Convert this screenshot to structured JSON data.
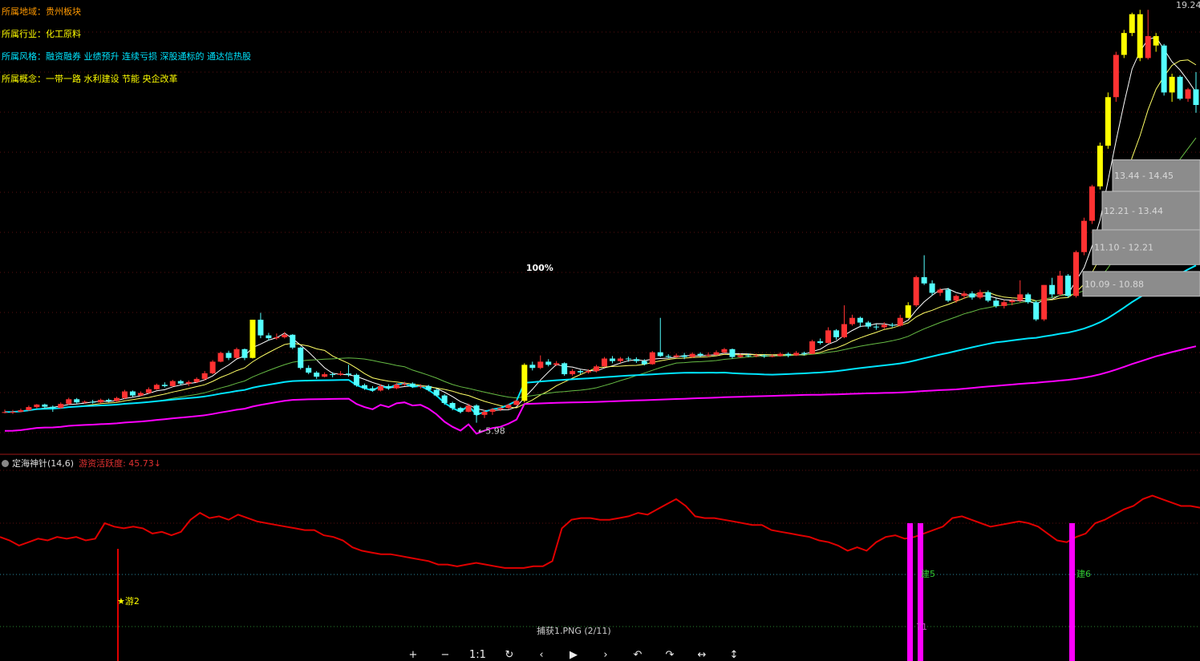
{
  "info": {
    "region_label": "所属地域：",
    "region_value": "贵州板块",
    "industry_label": "所属行业：",
    "industry_value": "化工原料",
    "style_label": "所属风格：",
    "style_value": "融资融券 业绩预升 连续亏损 深股通标的 通达信热股",
    "concept_label": "所属概念：",
    "concept_value": "一带一路 水利建设 节能 央企改革"
  },
  "colors": {
    "up": "#ff3232",
    "down": "#54ffff",
    "limit_up": "#ffff00",
    "ma60": "#00e5ff",
    "ma120": "#ff00ff",
    "indicator": "#e00000",
    "signal": "#ff00ff",
    "region": "#ff9900",
    "industry": "#ffff00",
    "style": "#00e5ff",
    "concept": "#ffff00"
  },
  "indicator": {
    "name": "定海神针(14,6)",
    "value_label": "游资活跃度:",
    "value": "45.73",
    "arrow": "↓"
  },
  "viewer": {
    "title": "捕获1.PNG (2/11)",
    "buttons": [
      "+",
      "−",
      "1:1",
      "↻",
      "‹",
      "▶",
      "›",
      "↶",
      "↷",
      "↔",
      "↕"
    ]
  },
  "chart_data": [
    {
      "type": "candlestick",
      "annotations": {
        "low_label": "←5.98",
        "pct_label": "100%",
        "high_label": "19.24",
        "chip_ranges": [
          "13.44 - 14.45",
          "12.21 - 13.44",
          "11.10 - 12.21",
          "10.09 - 10.88"
        ]
      },
      "ylim": [
        5.4,
        19.4
      ],
      "candles": [
        [
          6.37,
          6.39,
          6.47,
          6.35
        ],
        [
          6.39,
          6.4,
          6.46,
          6.33
        ],
        [
          6.4,
          6.45,
          6.5,
          6.38
        ],
        [
          6.45,
          6.55,
          6.6,
          6.43
        ],
        [
          6.55,
          6.63,
          6.65,
          6.5
        ],
        [
          6.63,
          6.56,
          6.66,
          6.5
        ],
        [
          6.56,
          6.52,
          6.6,
          6.4
        ],
        [
          6.52,
          6.65,
          6.7,
          6.5
        ],
        [
          6.65,
          6.8,
          6.85,
          6.62
        ],
        [
          6.8,
          6.7,
          6.84,
          6.66
        ],
        [
          6.7,
          6.72,
          6.76,
          6.66
        ],
        [
          6.72,
          6.7,
          6.78,
          6.66
        ],
        [
          6.7,
          6.78,
          6.82,
          6.67
        ],
        [
          6.78,
          6.74,
          6.82,
          6.7
        ],
        [
          6.74,
          6.84,
          6.88,
          6.72
        ],
        [
          6.84,
          7.05,
          7.1,
          6.8
        ],
        [
          7.05,
          6.92,
          7.08,
          6.88
        ],
        [
          6.92,
          7.0,
          7.05,
          6.9
        ],
        [
          7.0,
          7.12,
          7.18,
          6.98
        ],
        [
          7.12,
          7.26,
          7.3,
          7.1
        ],
        [
          7.26,
          7.22,
          7.34,
          7.18
        ],
        [
          7.22,
          7.38,
          7.42,
          7.2
        ],
        [
          7.38,
          7.3,
          7.42,
          7.25
        ],
        [
          7.3,
          7.35,
          7.4,
          7.22
        ],
        [
          7.35,
          7.45,
          7.5,
          7.32
        ],
        [
          7.45,
          7.63,
          7.7,
          7.4
        ],
        [
          7.63,
          8.0,
          8.05,
          7.6
        ],
        [
          8.0,
          8.28,
          8.32,
          7.98
        ],
        [
          8.28,
          8.12,
          8.35,
          8.05
        ],
        [
          8.12,
          8.4,
          8.45,
          8.1
        ],
        [
          8.4,
          8.12,
          8.42,
          8.05
        ],
        [
          8.12,
          9.34,
          9.34,
          8.1
        ],
        [
          9.34,
          8.84,
          9.56,
          8.75
        ],
        [
          8.84,
          8.75,
          8.92,
          8.68
        ],
        [
          8.75,
          8.78,
          8.9,
          8.7
        ],
        [
          8.78,
          8.86,
          8.95,
          8.74
        ],
        [
          8.86,
          8.45,
          8.88,
          8.4
        ],
        [
          8.45,
          7.8,
          8.48,
          7.75
        ],
        [
          7.8,
          7.65,
          7.88,
          7.6
        ],
        [
          7.65,
          7.52,
          7.7,
          7.45
        ],
        [
          7.52,
          7.6,
          7.66,
          7.5
        ],
        [
          7.6,
          7.58,
          7.66,
          7.5
        ],
        [
          7.58,
          7.62,
          7.7,
          7.55
        ],
        [
          7.62,
          7.58,
          7.9,
          7.52
        ],
        [
          7.58,
          7.25,
          7.62,
          7.2
        ],
        [
          7.25,
          7.15,
          7.3,
          7.1
        ],
        [
          7.15,
          7.08,
          7.22,
          7.04
        ],
        [
          7.08,
          7.22,
          7.28,
          7.05
        ],
        [
          7.22,
          7.15,
          7.28,
          7.1
        ],
        [
          7.15,
          7.27,
          7.32,
          7.12
        ],
        [
          7.27,
          7.3,
          7.36,
          7.22
        ],
        [
          7.3,
          7.2,
          7.34,
          7.16
        ],
        [
          7.2,
          7.22,
          7.28,
          7.14
        ],
        [
          7.22,
          7.1,
          7.26,
          7.05
        ],
        [
          7.1,
          6.92,
          7.14,
          6.88
        ],
        [
          6.92,
          6.68,
          6.96,
          6.62
        ],
        [
          6.68,
          6.52,
          6.72,
          6.45
        ],
        [
          6.52,
          6.4,
          6.56,
          6.35
        ],
        [
          6.4,
          6.6,
          6.66,
          6.38
        ],
        [
          6.6,
          6.3,
          6.64,
          6.05
        ],
        [
          6.3,
          6.4,
          6.46,
          6.2
        ],
        [
          6.4,
          6.48,
          6.52,
          6.3
        ],
        [
          6.48,
          6.52,
          6.56,
          6.42
        ],
        [
          6.52,
          6.62,
          6.66,
          6.48
        ],
        [
          6.62,
          6.75,
          6.8,
          6.6
        ],
        [
          6.75,
          7.9,
          7.95,
          6.7
        ],
        [
          7.9,
          7.8,
          8.0,
          7.72
        ],
        [
          7.8,
          8.0,
          8.2,
          7.76
        ],
        [
          8.0,
          7.9,
          8.08,
          7.85
        ],
        [
          7.9,
          7.95,
          8.02,
          7.86
        ],
        [
          7.95,
          7.6,
          7.98,
          7.55
        ],
        [
          7.6,
          7.7,
          7.76,
          7.55
        ],
        [
          7.7,
          7.66,
          7.74,
          7.6
        ],
        [
          7.66,
          7.7,
          7.76,
          7.62
        ],
        [
          7.7,
          7.85,
          7.9,
          7.66
        ],
        [
          7.85,
          8.1,
          8.15,
          7.82
        ],
        [
          8.1,
          8.02,
          8.18,
          7.95
        ],
        [
          8.02,
          8.1,
          8.15,
          7.96
        ],
        [
          8.1,
          8.08,
          8.16,
          8.0
        ],
        [
          8.08,
          8.02,
          8.14,
          7.96
        ],
        [
          8.02,
          7.92,
          8.08,
          7.88
        ],
        [
          7.92,
          8.3,
          8.34,
          7.9
        ],
        [
          8.3,
          8.18,
          9.4,
          8.15
        ],
        [
          8.18,
          8.15,
          8.24,
          8.1
        ],
        [
          8.15,
          8.2,
          8.26,
          8.12
        ],
        [
          8.2,
          8.15,
          8.28,
          8.08
        ],
        [
          8.15,
          8.25,
          8.3,
          8.12
        ],
        [
          8.25,
          8.2,
          8.3,
          8.15
        ],
        [
          8.2,
          8.22,
          8.3,
          8.15
        ],
        [
          8.22,
          8.3,
          8.36,
          8.2
        ],
        [
          8.3,
          8.4,
          8.44,
          8.26
        ],
        [
          8.4,
          8.15,
          8.42,
          8.1
        ],
        [
          8.15,
          8.2,
          8.26,
          8.12
        ],
        [
          8.2,
          8.18,
          8.26,
          8.14
        ],
        [
          8.18,
          8.2,
          8.26,
          8.14
        ],
        [
          8.2,
          8.18,
          8.24,
          8.12
        ],
        [
          8.18,
          8.18,
          8.24,
          8.14
        ],
        [
          8.18,
          8.25,
          8.3,
          8.16
        ],
        [
          8.25,
          8.2,
          8.3,
          8.14
        ],
        [
          8.2,
          8.28,
          8.34,
          8.18
        ],
        [
          8.28,
          8.25,
          8.32,
          8.2
        ],
        [
          8.25,
          8.65,
          8.7,
          8.24
        ],
        [
          8.65,
          8.6,
          8.74,
          8.55
        ],
        [
          8.6,
          9.0,
          9.1,
          8.58
        ],
        [
          9.0,
          8.78,
          9.04,
          8.7
        ],
        [
          8.78,
          9.2,
          9.8,
          8.75
        ],
        [
          9.2,
          9.4,
          9.5,
          9.15
        ],
        [
          9.4,
          9.25,
          9.44,
          9.1
        ],
        [
          9.25,
          9.12,
          9.3,
          9.05
        ],
        [
          9.12,
          9.1,
          9.2,
          9.02
        ],
        [
          9.1,
          9.18,
          9.26,
          9.05
        ],
        [
          9.18,
          9.15,
          9.24,
          9.1
        ],
        [
          9.15,
          9.4,
          9.5,
          9.12
        ],
        [
          9.4,
          9.8,
          9.9,
          9.38
        ],
        [
          9.8,
          10.7,
          10.75,
          9.75
        ],
        [
          10.7,
          10.5,
          11.4,
          10.45
        ],
        [
          10.5,
          10.2,
          10.6,
          10.12
        ],
        [
          10.2,
          10.3,
          10.35,
          10.1
        ],
        [
          10.3,
          9.95,
          10.36,
          9.9
        ],
        [
          9.95,
          10.1,
          10.15,
          9.88
        ],
        [
          10.1,
          10.18,
          10.25,
          10.0
        ],
        [
          10.18,
          10.05,
          10.25,
          9.98
        ],
        [
          10.05,
          10.22,
          10.3,
          10.0
        ],
        [
          10.22,
          9.95,
          10.28,
          9.9
        ],
        [
          9.95,
          9.78,
          10.02,
          9.72
        ],
        [
          9.78,
          9.9,
          9.96,
          9.7
        ],
        [
          9.9,
          9.95,
          10.0,
          9.8
        ],
        [
          9.95,
          10.15,
          10.6,
          9.9
        ],
        [
          10.15,
          9.9,
          10.2,
          9.85
        ],
        [
          9.9,
          9.35,
          9.95,
          9.3
        ],
        [
          9.35,
          10.45,
          10.45,
          9.3
        ],
        [
          10.45,
          10.15,
          10.68,
          10.05
        ],
        [
          10.15,
          10.75,
          10.9,
          10.1
        ],
        [
          10.75,
          10.1,
          10.8,
          10.05
        ],
        [
          10.1,
          11.5,
          11.55,
          10.05
        ],
        [
          11.5,
          12.5,
          12.6,
          11.4
        ],
        [
          12.5,
          13.6,
          13.65,
          12.4
        ],
        [
          13.6,
          14.9,
          15.0,
          13.5
        ],
        [
          14.9,
          16.45,
          16.6,
          14.8
        ],
        [
          16.45,
          17.8,
          17.9,
          16.3
        ],
        [
          17.8,
          18.5,
          18.6,
          17.7
        ],
        [
          18.5,
          19.1,
          19.15,
          18.4
        ],
        [
          19.1,
          17.7,
          19.24,
          17.6
        ],
        [
          17.7,
          18.4,
          19.24,
          17.65
        ],
        [
          18.4,
          18.1,
          18.5,
          17.9
        ],
        [
          18.1,
          16.6,
          18.15,
          16.5
        ],
        [
          16.6,
          17.1,
          17.2,
          16.3
        ],
        [
          17.1,
          16.4,
          17.15,
          16.35
        ],
        [
          16.4,
          16.7,
          16.75,
          16.3
        ],
        [
          16.7,
          16.2,
          17.25,
          15.95
        ]
      ],
      "limit_up_indices": [
        31,
        65,
        113,
        137,
        138,
        140,
        141,
        142,
        144,
        146
      ]
    },
    {
      "type": "line",
      "name": "定海神针(14,6)",
      "signal_labels": [
        "★游2",
        "建5",
        "建6",
        "71"
      ],
      "ylim": [
        0,
        100
      ],
      "values": [
        72,
        70,
        67,
        69,
        71,
        70,
        72,
        71,
        72,
        70,
        71,
        80,
        78,
        77,
        78,
        77,
        74,
        75,
        73,
        75,
        82,
        86,
        83,
        84,
        82,
        85,
        83,
        81,
        80,
        79,
        78,
        77,
        76,
        76,
        73,
        72,
        70,
        66,
        64,
        63,
        62,
        62,
        61,
        60,
        59,
        58,
        56,
        56,
        55,
        56,
        57,
        56,
        55,
        54,
        54,
        54,
        55,
        55,
        58,
        77,
        82,
        83,
        83,
        82,
        82,
        83,
        84,
        86,
        85,
        88,
        91,
        94,
        90,
        84,
        83,
        83,
        82,
        81,
        80,
        79,
        79,
        76,
        75,
        74,
        73,
        72,
        70,
        69,
        67,
        64,
        66,
        64,
        69,
        72,
        73,
        71,
        72,
        74,
        76,
        78,
        83,
        84,
        82,
        80,
        78,
        79,
        80,
        81,
        80,
        78,
        74,
        70,
        69,
        72,
        74,
        80,
        82,
        85,
        88,
        90,
        94,
        96,
        94,
        92,
        90,
        90,
        89
      ]
    }
  ]
}
